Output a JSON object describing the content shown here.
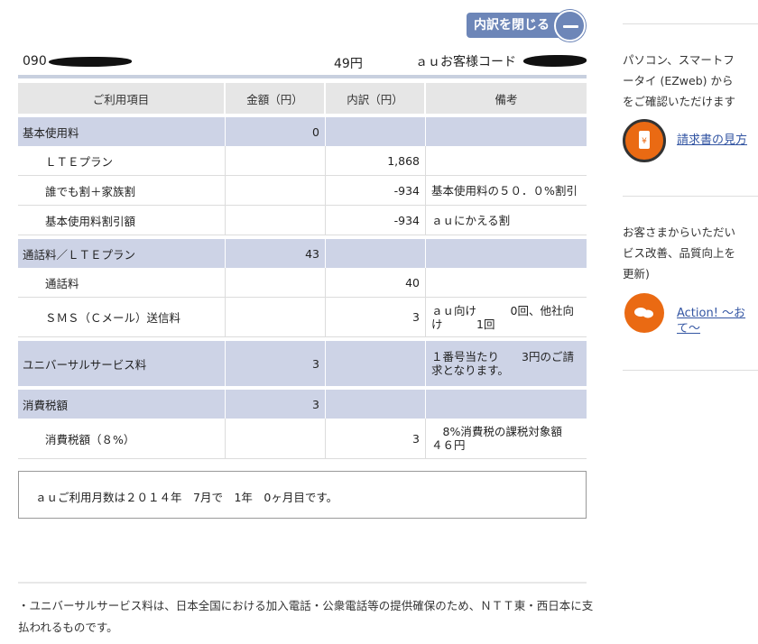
{
  "toggle": {
    "label": "内訳を閉じる"
  },
  "info": {
    "phone_prefix": "090",
    "amount": "49円",
    "code_label": "ａｕお客様コード"
  },
  "table": {
    "headers": [
      "ご利用項目",
      "金額（円）",
      "内訳（円）",
      "備考"
    ],
    "rows": [
      {
        "kind": "cat",
        "name": "基本使用料",
        "amount": "0",
        "detail": "",
        "note": ""
      },
      {
        "kind": "sub",
        "name": "ＬＴＥプラン",
        "amount": "",
        "detail": "1,868",
        "note": ""
      },
      {
        "kind": "sub",
        "name": "誰でも割＋家族割",
        "amount": "",
        "detail": "-934",
        "note": "基本使用料の５０．０%割引"
      },
      {
        "kind": "sub",
        "name": "基本使用料割引額",
        "amount": "",
        "detail": "-934",
        "note": "ａｕにかえる割"
      },
      {
        "kind": "cat",
        "name": "通話料／ＬＴＥプラン",
        "amount": "43",
        "detail": "",
        "note": ""
      },
      {
        "kind": "sub",
        "name": "通話料",
        "amount": "",
        "detail": "40",
        "note": ""
      },
      {
        "kind": "sub",
        "name": "ＳＭＳ（Ｃメール）送信料",
        "amount": "",
        "detail": "3",
        "note": "ａｕ向け　　　0回、他社向け　　　1回"
      },
      {
        "kind": "cat",
        "name": "ユニバーサルサービス料",
        "amount": "3",
        "detail": "",
        "note": "１番号当たり　　3円のご請求となります。"
      },
      {
        "kind": "cat",
        "name": "消費税額",
        "amount": "3",
        "detail": "",
        "note": ""
      },
      {
        "kind": "sub",
        "name": "消費税額（８%）",
        "amount": "",
        "detail": "3",
        "note": "　8%消費税の課税対象額　４６円"
      }
    ]
  },
  "months_text": "ａｕご利用月数は２０１４年　7月で　1年　0ヶ月目です。",
  "footnote": "・ユニバーサルサービス料は、日本全国における加入電話・公衆電話等の提供確保のため、ＮＴＴ東・西日本に支払われるものです。",
  "sidebar": {
    "text1_line1": "パソコン、スマートフ",
    "text1_line2": "ータイ (EZweb) から",
    "text1_line3": "をご確認いただけます",
    "link1": "請求書の見方",
    "text2_line1": "お客さまからいただい",
    "text2_line2": "ビス改善、品質向上を",
    "text2_line3": "更新)",
    "link2_line1": "Action! ～お",
    "link2_line2": "て～"
  },
  "colors": {
    "accent": "#6d86b8",
    "category_row": "#cdd3e6",
    "header_row": "#e6e6e6",
    "orange_icon": "#ea6a13",
    "link": "#3456a3"
  }
}
